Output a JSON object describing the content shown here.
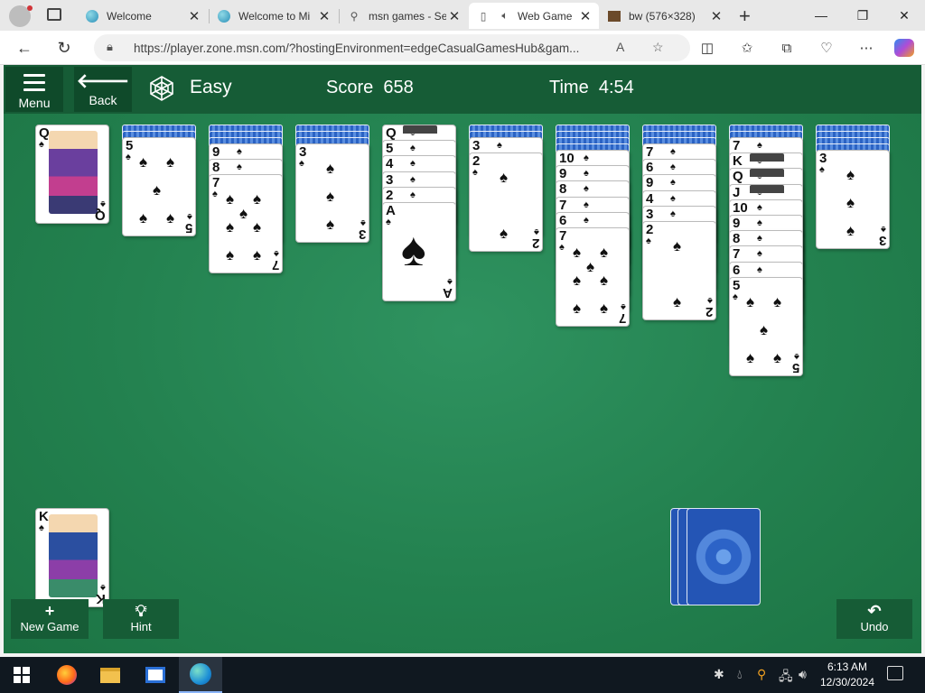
{
  "browser": {
    "tabs": [
      {
        "title": "Welcome"
      },
      {
        "title": "Welcome to Mi"
      },
      {
        "title": "msn games - Se"
      },
      {
        "title": "Web Game"
      },
      {
        "title": "bw (576×328)"
      }
    ],
    "url": "https://player.zone.msn.com/?hostingEnvironment=edgeCasualGamesHub&gam..."
  },
  "game": {
    "menu_label": "Menu",
    "back_label": "Back",
    "difficulty": "Easy",
    "score_label": "Score",
    "score_value": "658",
    "time_label": "Time",
    "time_value": "4:54",
    "new_game_label": "New Game",
    "hint_label": "Hint",
    "undo_label": "Undo",
    "suit": "♠",
    "foundation_top": {
      "rank": "Q"
    },
    "completed_top": {
      "rank": "K"
    },
    "tableau": [
      {
        "facedown": 2,
        "faceup": [
          "5"
        ]
      },
      {
        "facedown": 3,
        "faceup": [
          "9",
          "8",
          "7"
        ]
      },
      {
        "facedown": 3,
        "faceup": [
          "3"
        ]
      },
      {
        "facedown": 0,
        "faceup": [
          "Q",
          "5",
          "4",
          "3",
          "2",
          "A"
        ]
      },
      {
        "facedown": 2,
        "faceup": [
          "3",
          "2"
        ]
      },
      {
        "facedown": 4,
        "faceup": [
          "10",
          "9",
          "8",
          "7",
          "6",
          "7"
        ]
      },
      {
        "facedown": 3,
        "faceup": [
          "7",
          "6",
          "9",
          "4",
          "3",
          "2"
        ]
      },
      {
        "facedown": 2,
        "faceup": [
          "7",
          "K",
          "Q",
          "J",
          "10",
          "9",
          "8",
          "7",
          "6",
          "5"
        ]
      },
      {
        "facedown": 4,
        "faceup": [
          "3"
        ]
      }
    ],
    "stock_piles": 3
  },
  "taskbar": {
    "time": "6:13 AM",
    "date": "12/30/2024"
  }
}
